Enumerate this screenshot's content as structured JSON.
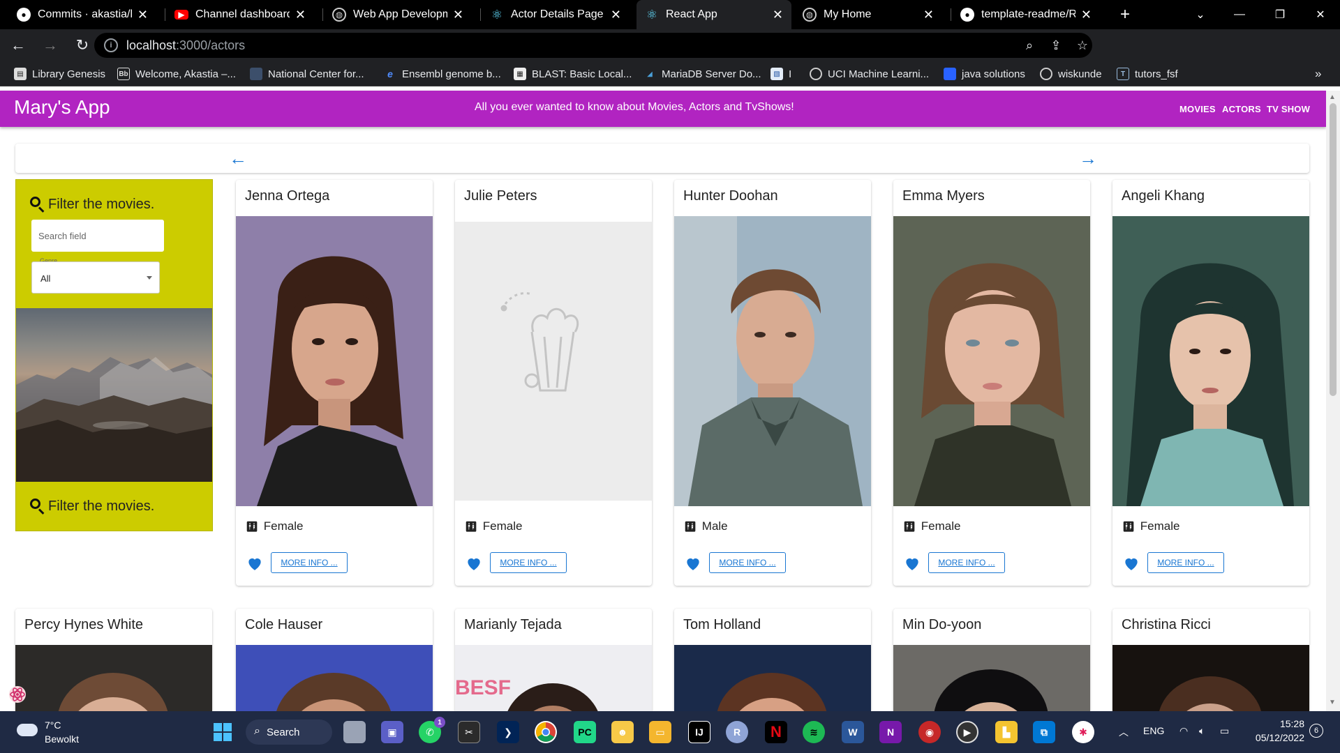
{
  "browser": {
    "tabs": [
      {
        "title": "Commits · akastia/lab",
        "icon": "github-icon",
        "active": false
      },
      {
        "title": "Channel dashboard -",
        "icon": "youtube-icon",
        "active": false
      },
      {
        "title": "Web App Developme",
        "icon": "globe-icon",
        "active": false
      },
      {
        "title": "Actor Details Page / A",
        "icon": "react-icon",
        "active": false
      },
      {
        "title": "React App",
        "icon": "react-icon",
        "active": true
      },
      {
        "title": "My Home",
        "icon": "globe-icon",
        "active": false
      },
      {
        "title": "template-readme/RE",
        "icon": "github-icon",
        "active": false
      }
    ],
    "url_host": "localhost",
    "url_path": ":3000/actors",
    "bookmarks": [
      {
        "label": "Library Genesis",
        "icon": "book-icon"
      },
      {
        "label": "Welcome, Akastia –...",
        "icon": "bb-icon"
      },
      {
        "label": "National Center for...",
        "icon": "folder-icon"
      },
      {
        "label": "Ensembl genome b...",
        "icon": "ensembl-icon"
      },
      {
        "label": "BLAST: Basic Local...",
        "icon": "blast-icon"
      },
      {
        "label": "MariaDB Server Do...",
        "icon": "mariadb-icon"
      },
      {
        "label": "I",
        "icon": "flag-icon"
      },
      {
        "label": "UCI Machine Learni...",
        "icon": "globe-icon"
      },
      {
        "label": "java solutions",
        "icon": "bookmark-icon"
      },
      {
        "label": "wiskunde",
        "icon": "globe-icon"
      },
      {
        "label": "tutors_fsf",
        "icon": "tutors-icon"
      }
    ],
    "bookmarks_overflow": "»"
  },
  "app": {
    "title": "Mary's App",
    "tagline": "All you ever wanted to know about Movies, Actors and TvShows!",
    "nav": [
      "MOVIES",
      "ACTORS",
      "TV SHOW"
    ]
  },
  "pager": {
    "prev": "←",
    "next": "→"
  },
  "filter": {
    "heading": "Filter the movies.",
    "heading_bottom": "Filter the movies.",
    "search_placeholder": "Search field",
    "genre_label": "Genre",
    "genre_value": "All"
  },
  "actors": [
    {
      "name": "Jenna Ortega",
      "gender": "Female",
      "more": "MORE INFO ...",
      "photo": "portrait"
    },
    {
      "name": "Julie Peters",
      "gender": "Female",
      "more": "MORE INFO ...",
      "photo": "placeholder"
    },
    {
      "name": "Hunter Doohan",
      "gender": "Male",
      "more": "MORE INFO ...",
      "photo": "portrait"
    },
    {
      "name": "Emma Myers",
      "gender": "Female",
      "more": "MORE INFO ...",
      "photo": "portrait"
    },
    {
      "name": "Angeli Khang",
      "gender": "Female",
      "more": "MORE INFO ...",
      "photo": "portrait"
    }
  ],
  "actors_row2": [
    {
      "name": "Percy Hynes White"
    },
    {
      "name": "Cole Hauser"
    },
    {
      "name": "Marianly Tejada",
      "photo_text": "BESF"
    },
    {
      "name": "Tom Holland"
    },
    {
      "name": "Min Do-yoon"
    },
    {
      "name": "Christina Ricci"
    }
  ],
  "taskbar": {
    "temperature": "7°C",
    "condition": "Bewolkt",
    "search_label": "Search",
    "language": "ENG",
    "time": "15:28",
    "date": "05/12/2022",
    "notification_count": "6",
    "whatsapp_badge": "1"
  },
  "colors": {
    "appbar": "#b124c1",
    "filter_panel": "#cccc00",
    "accent": "#1976d2"
  }
}
